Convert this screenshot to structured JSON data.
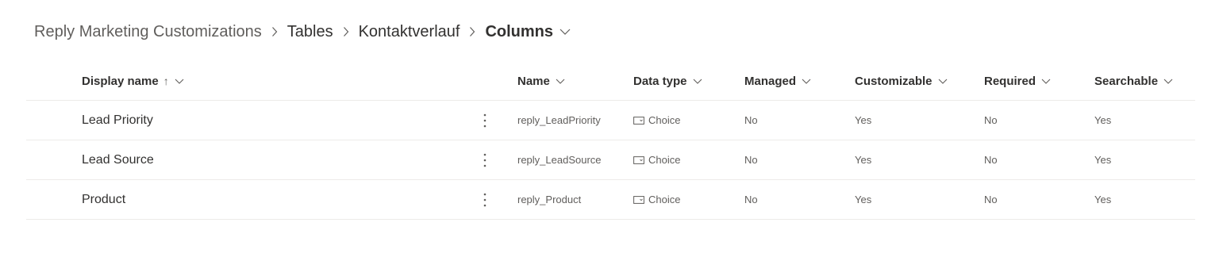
{
  "breadcrumb": {
    "items": [
      "Reply Marketing Customizations",
      "Tables",
      "Kontaktverlauf"
    ],
    "current": "Columns"
  },
  "table": {
    "columns": {
      "display_name": "Display name",
      "name": "Name",
      "data_type": "Data type",
      "managed": "Managed",
      "customizable": "Customizable",
      "required": "Required",
      "searchable": "Searchable"
    },
    "sort_indicator": "↑",
    "rows": [
      {
        "display_name": "Lead Priority",
        "name": "reply_LeadPriority",
        "data_type": "Choice",
        "managed": "No",
        "customizable": "Yes",
        "required": "No",
        "searchable": "Yes"
      },
      {
        "display_name": "Lead Source",
        "name": "reply_LeadSource",
        "data_type": "Choice",
        "managed": "No",
        "customizable": "Yes",
        "required": "No",
        "searchable": "Yes"
      },
      {
        "display_name": "Product",
        "name": "reply_Product",
        "data_type": "Choice",
        "managed": "No",
        "customizable": "Yes",
        "required": "No",
        "searchable": "Yes"
      }
    ]
  },
  "icons": {
    "separator": "chevron-right-icon",
    "dropdown": "chevron-down-icon",
    "more": "more-vertical-icon",
    "choice_type": "choice-type-icon"
  },
  "colors": {
    "text_primary": "#323130",
    "text_secondary": "#605e5c",
    "divider": "#edebe9"
  }
}
